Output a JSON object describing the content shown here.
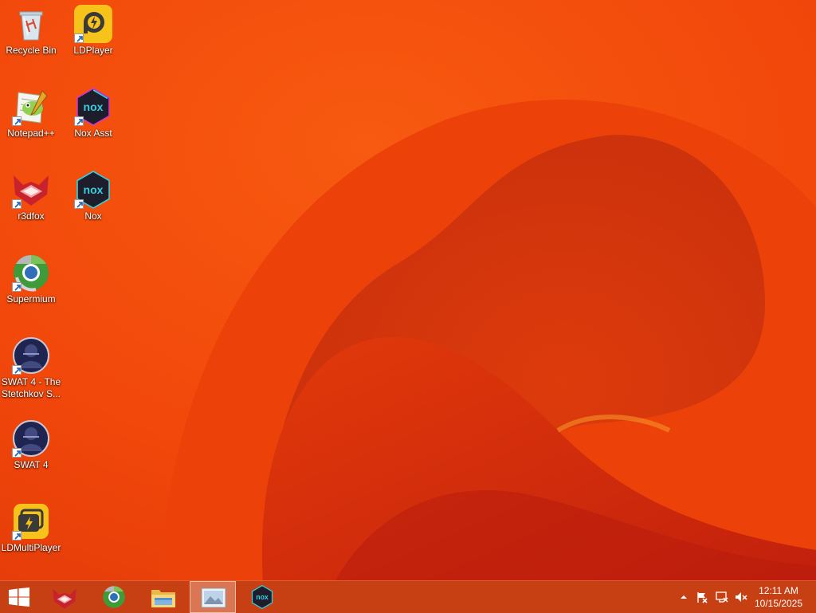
{
  "desktop": {
    "icons": [
      {
        "label": "Recycle Bin",
        "icon": "recycle-bin-icon"
      },
      {
        "label": "LDPlayer",
        "icon": "ldplayer-icon"
      },
      {
        "label": "Notepad++",
        "icon": "notepad-plus-plus-icon"
      },
      {
        "label": "Nox Asst",
        "icon": "nox-asst-icon"
      },
      {
        "label": "r3dfox",
        "icon": "r3dfox-icon"
      },
      {
        "label": "Nox",
        "icon": "nox-icon"
      },
      {
        "label": "Supermium",
        "icon": "supermium-icon"
      },
      {
        "label": "SWAT 4 - The Stetchkov S...",
        "icon": "swat4-stetchkov-icon"
      },
      {
        "label": "SWAT 4",
        "icon": "swat4-icon"
      },
      {
        "label": "LDMultiPlayer",
        "icon": "ldmultiplayer-icon"
      }
    ]
  },
  "taskbar": {
    "pinned": [
      {
        "name": "r3dfox",
        "icon": "r3dfox-icon"
      },
      {
        "name": "Supermium",
        "icon": "supermium-icon"
      },
      {
        "name": "File Explorer",
        "icon": "file-explorer-icon"
      },
      {
        "name": "Image Viewer",
        "icon": "image-viewer-icon",
        "active": true
      },
      {
        "name": "Nox",
        "icon": "nox-icon"
      }
    ],
    "tray": {
      "icons": [
        "chevron-up-icon",
        "action-center-flag-icon",
        "network-icon",
        "volume-muted-icon"
      ]
    },
    "clock": {
      "time": "12:11 AM",
      "date": "10/15/2025"
    }
  },
  "colors": {
    "wallpaper_base": "#f2480b",
    "wallpaper_dark": "#c8200a",
    "taskbar": "#c44016",
    "nox_teal": "#35d0e0",
    "ldplayer_yellow": "#f7c21a"
  }
}
